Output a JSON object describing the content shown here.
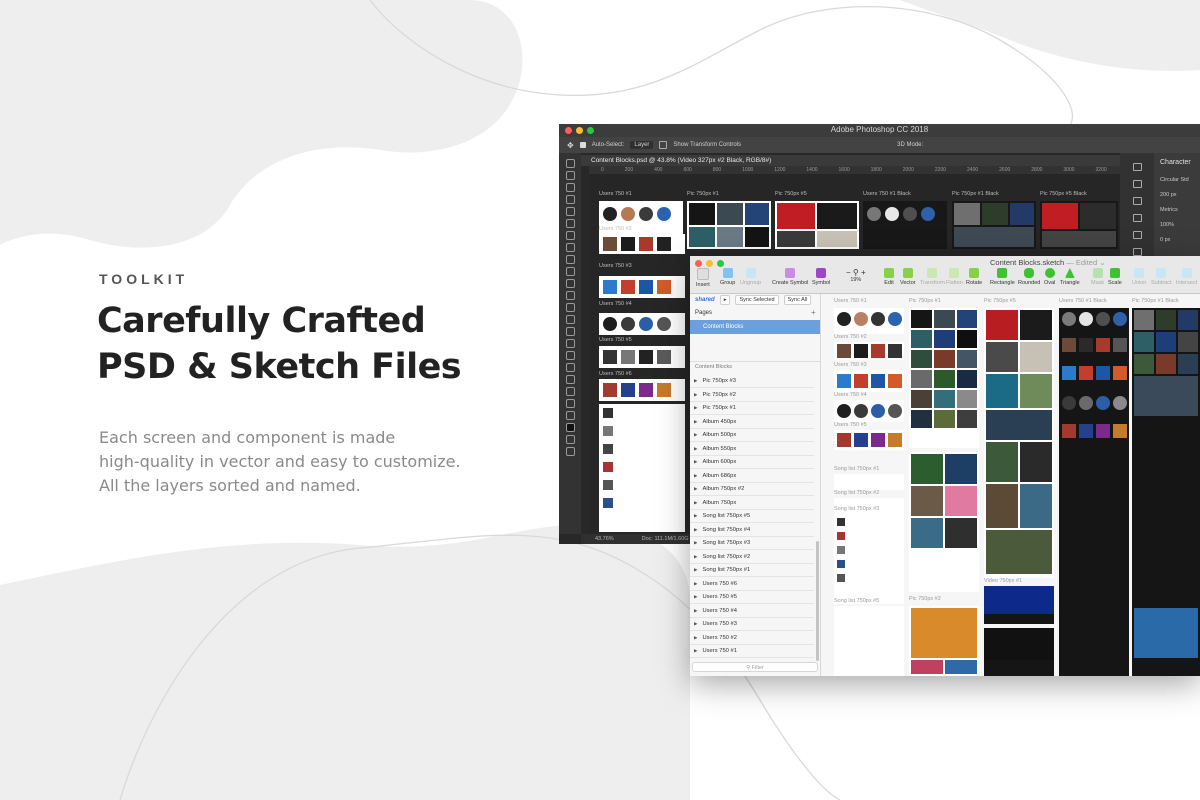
{
  "hero": {
    "eyebrow": "TOOLKIT",
    "headline_line1": "Carefully Crafted",
    "headline_line2": "PSD & Sketch Files",
    "blurb_line1": "Each screen and component is made",
    "blurb_line2": "high-quality in vector and easy to customize.",
    "blurb_line3": "All the layers sorted and named."
  },
  "photoshop": {
    "window_title": "Adobe Photoshop CC 2018",
    "options": {
      "auto_select": "Auto-Select:",
      "layer": "Layer",
      "show_transform": "Show Transform Controls",
      "mode_3d": "3D Mode:"
    },
    "doc_tab": "Content Blocks.psd @ 43.8% (Video 327px #2 Black, RGB/8#)",
    "ruler_ticks": [
      "0",
      "200",
      "400",
      "600",
      "800",
      "1000",
      "1200",
      "1400",
      "1600",
      "1800",
      "2000",
      "2200",
      "2400",
      "2600",
      "2800",
      "3000",
      "3200",
      "3400",
      "3600",
      "3800",
      "4000",
      "4200"
    ],
    "columns": [
      "Users 750 #1",
      "Pic 750px #1",
      "Pic 750px #5",
      "Users 750 #1 Black",
      "Pic 750px #1 Black",
      "Pic 750px #5 Black"
    ],
    "left_labels": [
      "Users 750 #2",
      "Users 750 #3",
      "Users 750 #4",
      "Users 750 #5",
      "Users 750 #6"
    ],
    "status_zoom": "43.76%",
    "status_doc": "Doc: 111.1M/1.60G",
    "character_panel": {
      "title": "Character",
      "font": "Circular Std",
      "size": "200 px",
      "kerning": "Metrics",
      "scale": "100%",
      "baseline": "0 px"
    }
  },
  "sketch": {
    "window_title": "Content Blocks.sketch",
    "edited": "— Edited ⌄",
    "toolbar": {
      "insert": "Insert",
      "group": "Group",
      "ungroup": "Ungroup",
      "create_symbol": "Create Symbol",
      "symbol": "Symbol",
      "zoom": "19%",
      "edit": "Edit",
      "vector": "Vector",
      "transform": "Transform",
      "flatten": "Flatten",
      "rotate": "Rotate",
      "rectangle": "Rectangle",
      "rounded": "Rounded",
      "oval": "Oval",
      "triangle": "Triangle",
      "mask": "Mask",
      "scale": "Scale",
      "union": "Union",
      "subtract": "Subtract",
      "intersect": "Intersect"
    },
    "sync_logo": "shared",
    "sync_selected": "Sync Selected",
    "sync_all": "Sync All",
    "pages_title": "Pages",
    "selected_page": "Content Blocks",
    "layers_title": "Content Blocks",
    "layers": [
      "Pic 750px #3",
      "Pic 750px #2",
      "Pic 750px #1",
      "Album 450px",
      "Album 500px",
      "Album 550px",
      "Album 600px",
      "Album 686px",
      "Album 750px #2",
      "Album 750px",
      "Song list 750px #5",
      "Song list 750px #4",
      "Song list 750px #3",
      "Song list 750px #2",
      "Song list 750px #1",
      "Users 750 #6",
      "Users 750 #5",
      "Users 750 #4",
      "Users 750 #3",
      "Users 750 #2",
      "Users 750 #1"
    ],
    "filter_placeholder": "Filter",
    "columns": [
      "Users 750 #1",
      "Pic 750px #1",
      "Pic 750px #5",
      "Users 750 #1 Black",
      "Pic 750px #1 Black"
    ],
    "canvas_labels": [
      "Users 750 #2",
      "Users 750 #3",
      "Users 750 #4",
      "Users 750 #5",
      "Users 750 #6",
      "Song list 750px #1",
      "Song list 750px #2",
      "Song list 750px #3",
      "Song list 750px #4",
      "Song list 750px #5",
      "Pic 750px #2",
      "Video 750px #1"
    ]
  }
}
